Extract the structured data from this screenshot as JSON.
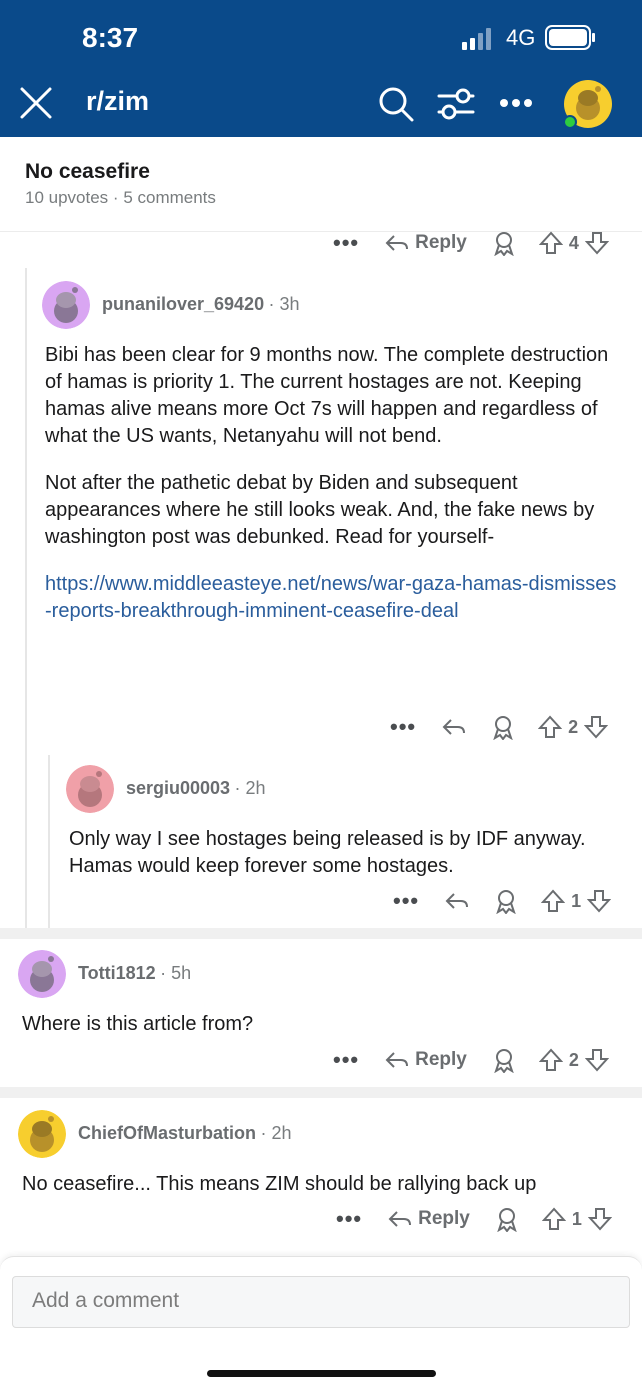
{
  "status": {
    "time": "8:37",
    "network": "4G"
  },
  "nav": {
    "title": "r/zim"
  },
  "post": {
    "title": "No ceasefire",
    "upvotes": "10 upvotes",
    "comments": "5 comments"
  },
  "top_actions": {
    "reply": "Reply",
    "votes": "4"
  },
  "comments": [
    {
      "user": "punanilover_69420",
      "age": "3h",
      "paragraphs": [
        "Bibi has been clear for 9 months now. The complete destruction of hamas is priority 1. The current hostages are not. Keeping hamas alive means more Oct 7s will happen and regardless of what the US wants, Netanyahu will not bend.",
        "Not after the pathetic debat by Biden and subsequent appearances where he still looks weak. And, the fake news by washington post was debunked. Read for yourself-"
      ],
      "link": "https://www.middleeasteye.net/news/war-gaza-hamas-dismisses-reports-breakthrough-imminent-ceasefire-deal",
      "votes": "2"
    },
    {
      "user": "sergiu00003",
      "age": "2h",
      "text": "Only way I see hostages being released is by IDF anyway. Hamas would keep forever some hostages.",
      "votes": "1"
    },
    {
      "user": "Totti1812",
      "age": "5h",
      "text": "Where is this article from?",
      "reply": "Reply",
      "votes": "2"
    },
    {
      "user": "ChiefOfMasturbation",
      "age": "2h",
      "text": "No ceasefire... This means ZIM should be rallying back up",
      "reply": "Reply",
      "votes": "1"
    }
  ],
  "composer": {
    "placeholder": "Add a comment"
  },
  "colors": {
    "header": "#0a4a8a",
    "link": "#2a5d9c",
    "avatar_purple": "#d9a6f2",
    "avatar_pink": "#f0a0a8",
    "avatar_yellow": "#f7ce2e"
  },
  "icons": [
    "close-icon",
    "search-icon",
    "filter-icon",
    "more-icon",
    "user-avatar-icon",
    "reply-icon",
    "award-icon",
    "upvote-icon",
    "downvote-icon"
  ]
}
